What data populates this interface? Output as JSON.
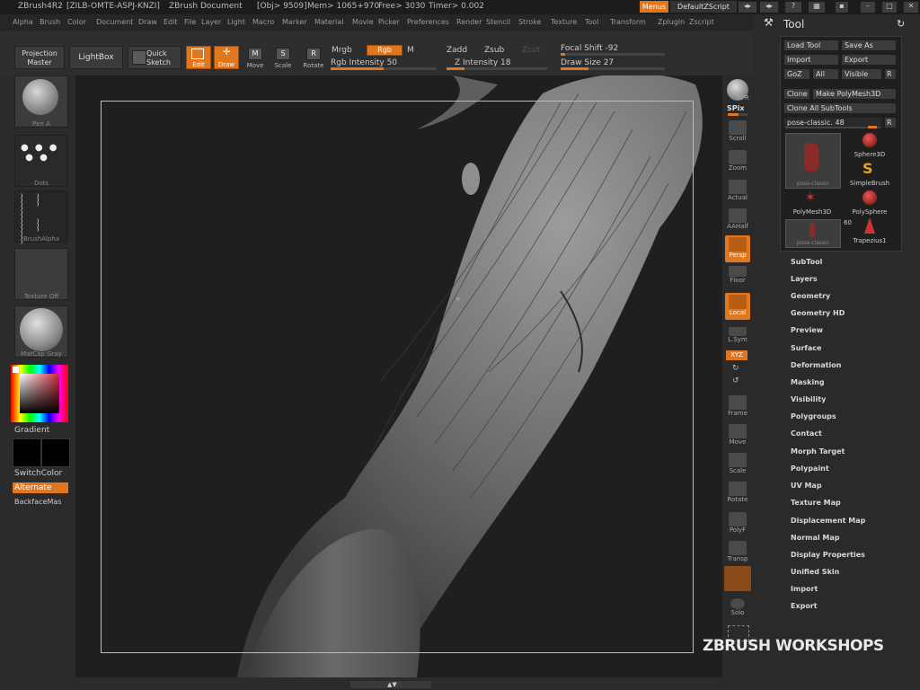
{
  "titlebar": {
    "app": "ZBrush4R2",
    "license": "[ZILB-OMTE-ASPJ-KNZI]",
    "doc": "ZBrush Document",
    "obj": "[Obj> 9509]",
    "mem": "Mem> 1065+970",
    "free": "Free> 3030",
    "timer": "Timer> 0.002",
    "menus_btn": "Menus",
    "script_btn": "DefaultZScript"
  },
  "menubar": [
    "Alpha",
    "Brush",
    "Color",
    "Document",
    "Draw",
    "Edit",
    "File",
    "Layer",
    "Light",
    "Macro",
    "Marker",
    "Material",
    "Movie",
    "Picker",
    "Preferences",
    "Render",
    "Stencil",
    "Stroke",
    "Texture",
    "Tool",
    "Transform",
    "Zplugin",
    "Zscript"
  ],
  "toolbar": {
    "projection_master": "Projection Master",
    "lightbox": "LightBox",
    "quick_sketch": "Quick Sketch",
    "edit": "Edit",
    "draw": "Draw",
    "move": "Move",
    "scale": "Scale",
    "rotate": "Rotate",
    "mrgb": "Mrgb",
    "rgb": "Rgb",
    "m": "M",
    "rgb_intensity": "Rgb Intensity 50",
    "rgb_intensity_value": 50,
    "zadd": "Zadd",
    "zsub": "Zsub",
    "zcut": "Zcut",
    "z_intensity": "Z Intensity 18",
    "z_intensity_value": 18,
    "focal_shift": "Focal Shift -92",
    "focal_shift_value": -92,
    "draw_size": "Draw Size 27",
    "draw_size_value": 27
  },
  "leftshelf": {
    "brush": "Pen A",
    "stroke": "Dots",
    "alpha": "BrushAlpha",
    "texture": "Texture Off",
    "material": "MatCap Gray",
    "gradient": "Gradient",
    "switchcolor": "SwitchColor",
    "alternate": "Alternate",
    "backface": "BackfaceMas"
  },
  "rightshelf": [
    "BPR",
    "SPix",
    "Scroll",
    "Zoom",
    "Actual",
    "AAHalf",
    "Persp",
    "Floor",
    "Local",
    "L.Sym",
    "XYZ",
    "Frame",
    "Move",
    "Scale",
    "Rotate",
    "PolyF",
    "Transp",
    "Solo"
  ],
  "toolpanel": {
    "title": "Tool",
    "load_tool": "Load Tool",
    "save_as": "Save As",
    "import": "Import",
    "export": "Export",
    "goz": "GoZ",
    "all": "All",
    "visible": "Visible",
    "r": "R",
    "clone": "Clone",
    "make_polymesh": "Make PolyMesh3D",
    "clone_all": "Clone All SubTools",
    "current_tool": "pose-classic. 48",
    "tools": [
      "Sphere3D",
      "SimpleBrush",
      "PolyMesh3D",
      "PolySphere",
      "Trapezius1"
    ],
    "thumb_caption": "pose-classic",
    "subtool_count": "60",
    "sections": [
      "SubTool",
      "Layers",
      "Geometry",
      "Geometry HD",
      "Preview",
      "Surface",
      "Deformation",
      "Masking",
      "Visibility",
      "Polygroups",
      "Contact",
      "Morph Target",
      "Polypaint",
      "UV Map",
      "Texture Map",
      "Displacement Map",
      "Normal Map",
      "Display Properties",
      "Unified Skin",
      "Import",
      "Export"
    ]
  },
  "watermark": "ZBRUSH WORKSHOPS"
}
